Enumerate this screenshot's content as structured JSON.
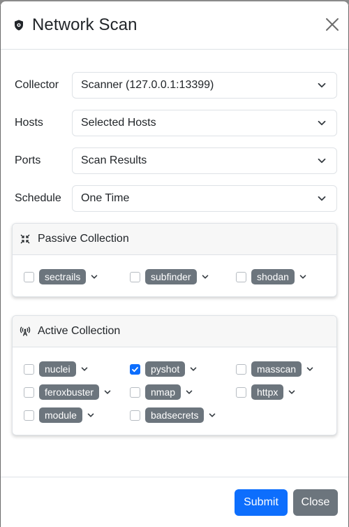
{
  "modal": {
    "title": "Network Scan",
    "close_icon": "close-icon",
    "title_icon": "shield-eye-icon"
  },
  "form": {
    "rows": [
      {
        "label": "Collector",
        "value": "Scanner (127.0.0.1:13399)"
      },
      {
        "label": "Hosts",
        "value": "Selected Hosts"
      },
      {
        "label": "Ports",
        "value": "Scan Results"
      },
      {
        "label": "Schedule",
        "value": "One Time"
      }
    ]
  },
  "passive": {
    "title": "Passive Collection",
    "icon": "compress-arrows-icon",
    "modules": [
      {
        "name": "sectrails",
        "checked": false
      },
      {
        "name": "subfinder",
        "checked": false
      },
      {
        "name": "shodan",
        "checked": false
      }
    ]
  },
  "active": {
    "title": "Active Collection",
    "icon": "broadcast-tower-icon",
    "modules": [
      {
        "name": "nuclei",
        "checked": false
      },
      {
        "name": "pyshot",
        "checked": true
      },
      {
        "name": "masscan",
        "checked": false
      },
      {
        "name": "feroxbuster",
        "checked": false
      },
      {
        "name": "nmap",
        "checked": false
      },
      {
        "name": "httpx",
        "checked": false
      },
      {
        "name": "module",
        "checked": false
      },
      {
        "name": "badsecrets",
        "checked": false
      }
    ]
  },
  "footer": {
    "submit_label": "Submit",
    "close_label": "Close"
  },
  "colors": {
    "primary": "#0d6efd",
    "secondary": "#6c757d",
    "badge": "#6c757d"
  }
}
